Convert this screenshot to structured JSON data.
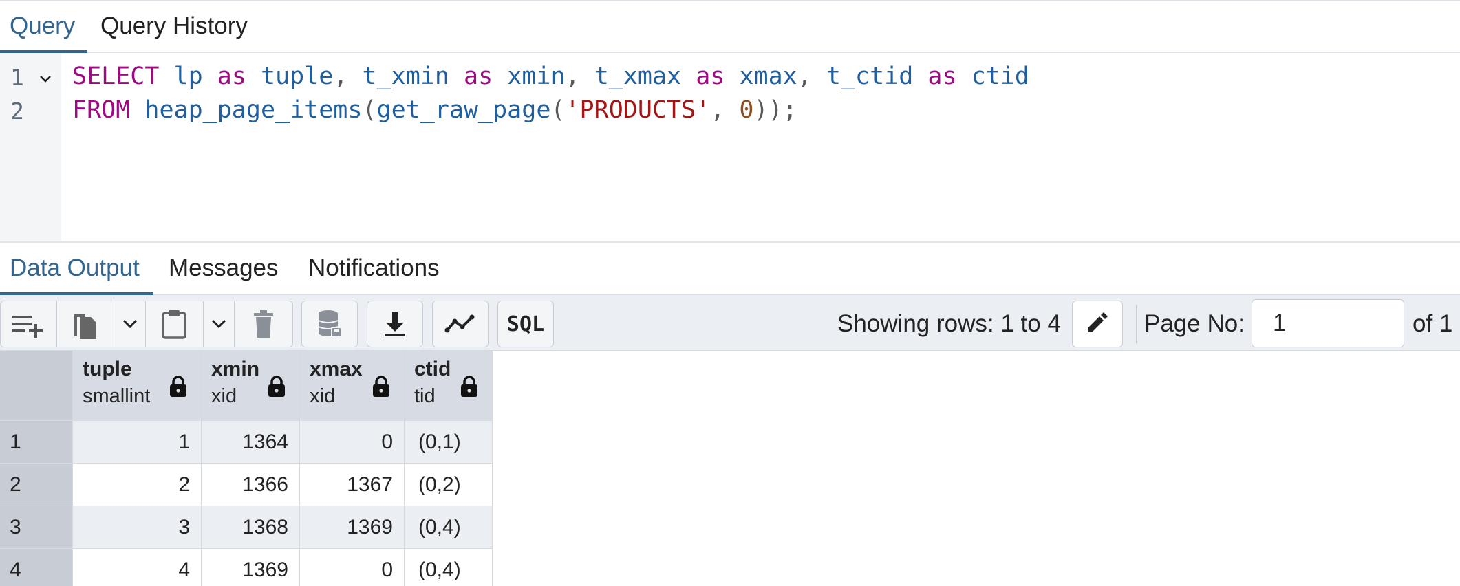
{
  "tabs": {
    "query": "Query",
    "query_history": "Query History"
  },
  "editor": {
    "line_numbers": [
      "1",
      "2"
    ]
  },
  "output_tabs": {
    "data_output": "Data Output",
    "messages": "Messages",
    "notifications": "Notifications"
  },
  "toolbar": {
    "sql_label": "SQL",
    "rows_text": "Showing rows: 1 to 4",
    "page_label": "Page No:",
    "page_value": "1",
    "page_of": "of 1"
  },
  "icons": {
    "add_row": "add-row-icon",
    "copy": "copy-icon",
    "paste": "paste-icon",
    "delete": "trash-icon",
    "save_data": "database-save-icon",
    "download": "download-icon",
    "graph": "graph-icon",
    "edit": "pencil-icon",
    "lock": "lock-icon"
  },
  "colors": {
    "accent": "#326690",
    "keyword": "#9d0b83",
    "identifier": "#1f5fa0",
    "string": "#a11515",
    "number": "#8f4e1f"
  },
  "grid": {
    "columns": [
      {
        "name": "tuple",
        "type": "smallint"
      },
      {
        "name": "xmin",
        "type": "xid"
      },
      {
        "name": "xmax",
        "type": "xid"
      },
      {
        "name": "ctid",
        "type": "tid"
      }
    ],
    "rows": [
      {
        "n": "1",
        "tuple": "1",
        "xmin": "1364",
        "xmax": "0",
        "ctid": "(0,1)"
      },
      {
        "n": "2",
        "tuple": "2",
        "xmin": "1366",
        "xmax": "1367",
        "ctid": "(0,2)"
      },
      {
        "n": "3",
        "tuple": "3",
        "xmin": "1368",
        "xmax": "1369",
        "ctid": "(0,4)"
      },
      {
        "n": "4",
        "tuple": "4",
        "xmin": "1369",
        "xmax": "0",
        "ctid": "(0,4)"
      }
    ]
  },
  "code": {
    "line1": {
      "select": "SELECT",
      "lp": "lp",
      "as1": "as",
      "tuple": "tuple",
      "comma1": ",",
      "t_xmin": "t_xmin",
      "as2": "as",
      "xmin": "xmin",
      "comma2": ",",
      "t_xmax": "t_xmax",
      "as3": "as",
      "xmax": "xmax",
      "comma3": ",",
      "t_ctid": "t_ctid",
      "as4": "as",
      "ctid": "ctid"
    },
    "line2": {
      "from": "FROM",
      "heap_page_items": "heap_page_items",
      "paren1": "(",
      "get_raw_page": "get_raw_page",
      "paren2": "(",
      "table": "'PRODUCTS'",
      "comma": ",",
      "zero": "0",
      "close": "));"
    }
  }
}
